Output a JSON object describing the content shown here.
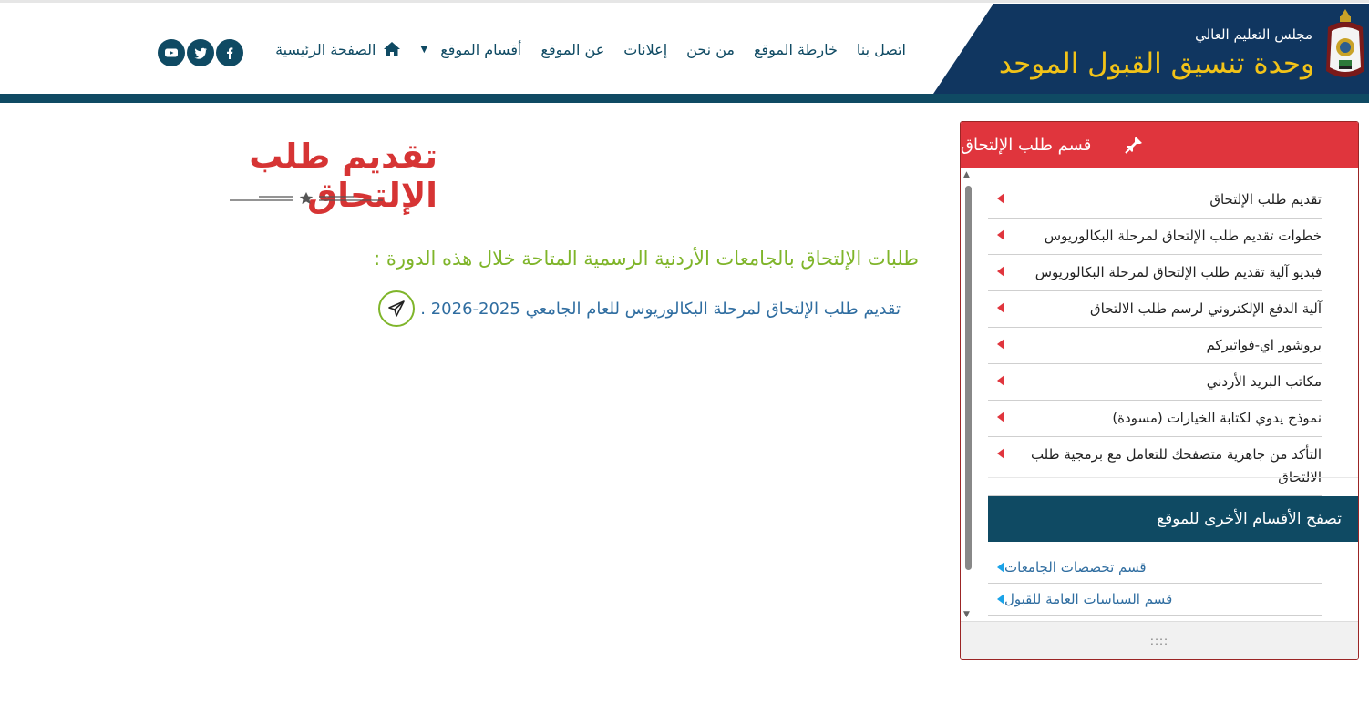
{
  "header": {
    "org_name": "مجلس التعليم العالي",
    "unit_name": "وحدة تنسيق القبول الموحد",
    "nav": [
      {
        "label": "الصفحة الرئيسية",
        "icon": "home-icon"
      },
      {
        "label": "أقسام الموقع",
        "icon": "caret-down-icon"
      },
      {
        "label": "عن الموقع"
      },
      {
        "label": "إعلانات"
      },
      {
        "label": "من نحن"
      },
      {
        "label": "خارطة الموقع"
      },
      {
        "label": "اتصل بنا"
      }
    ],
    "social": [
      "facebook-icon",
      "twitter-icon",
      "youtube-icon"
    ],
    "colors": {
      "brand_bg": "#103660",
      "brand_gold": "#f2c318",
      "band": "#0f4a63"
    }
  },
  "main": {
    "title": "تقديم طلب الإلتحاق",
    "intro": "طلبات الإلتحاق بالجامعات الأردنية الرسمية المتاحة خلال هذه الدورة :",
    "apply_link": "تقديم طلب الإلتحاق لمرحلة البكالوريوس للعام الجامعي 2025-2026 ."
  },
  "sidebar": {
    "title": "قسم طلب الإلتحاق",
    "items": [
      "تقديم طلب الإلتحاق",
      "خطوات تقديم طلب الإلتحاق لمرحلة البكالوريوس",
      "فيديو آلية تقديم طلب الإلتحاق لمرحلة البكالوريوس",
      "آلية الدفع الإلكتروني لرسم طلب الالتحاق",
      "بروشور اي-فواتيركم",
      "مكاتب البريد الأردني",
      "نموذج يدوي لكتابة الخيارات (مسودة)",
      "التأكد من جاهزية متصفحك للتعامل مع برمجية طلب الالتحاق"
    ],
    "other_title": "تصفح الأقسام الأخرى للموقع",
    "other_items": [
      "قسم تخصصات الجامعات",
      "قسم السياسات العامة للقبول"
    ],
    "footer": "::::",
    "colors": {
      "head": "#e0353d",
      "other_head": "#0f4a63",
      "link": "#2f6da0",
      "accent_green": "#7fb52a"
    }
  }
}
